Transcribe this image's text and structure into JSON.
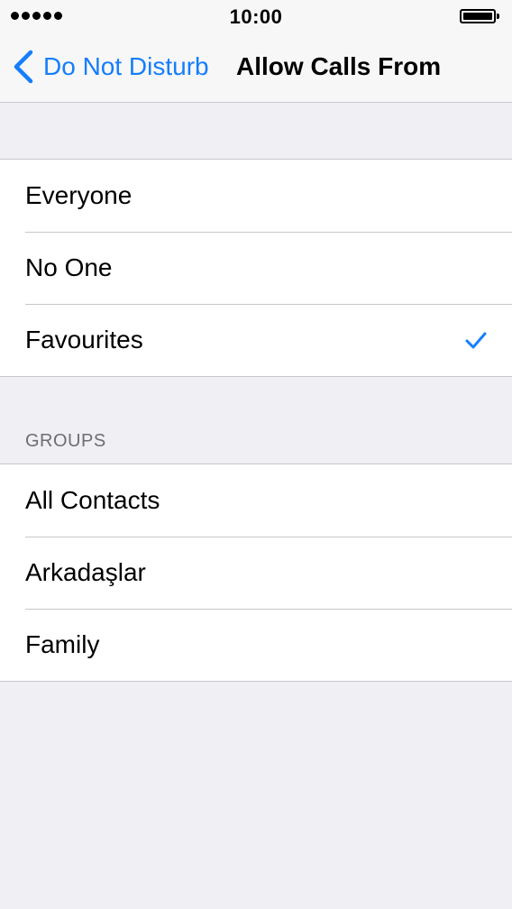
{
  "status_bar": {
    "time": "10:00",
    "signal_dots": 5,
    "battery_level": 1.0
  },
  "nav": {
    "back_label": "Do Not Disturb",
    "title": "Allow Calls From"
  },
  "options": [
    {
      "label": "Everyone",
      "selected": false
    },
    {
      "label": "No One",
      "selected": false
    },
    {
      "label": "Favourites",
      "selected": true
    }
  ],
  "groups": {
    "header": "GROUPS",
    "items": [
      {
        "label": "All Contacts"
      },
      {
        "label": "Arkadaşlar"
      },
      {
        "label": "Family"
      }
    ]
  },
  "colors": {
    "accent": "#157efb",
    "background": "#efeff4",
    "separator": "#c8c7cc",
    "section_header": "#6d6d72"
  },
  "icons": {
    "back": "chevron-left-icon",
    "selected": "checkmark-icon",
    "battery": "battery-icon",
    "signal": "signal-dots-icon"
  }
}
